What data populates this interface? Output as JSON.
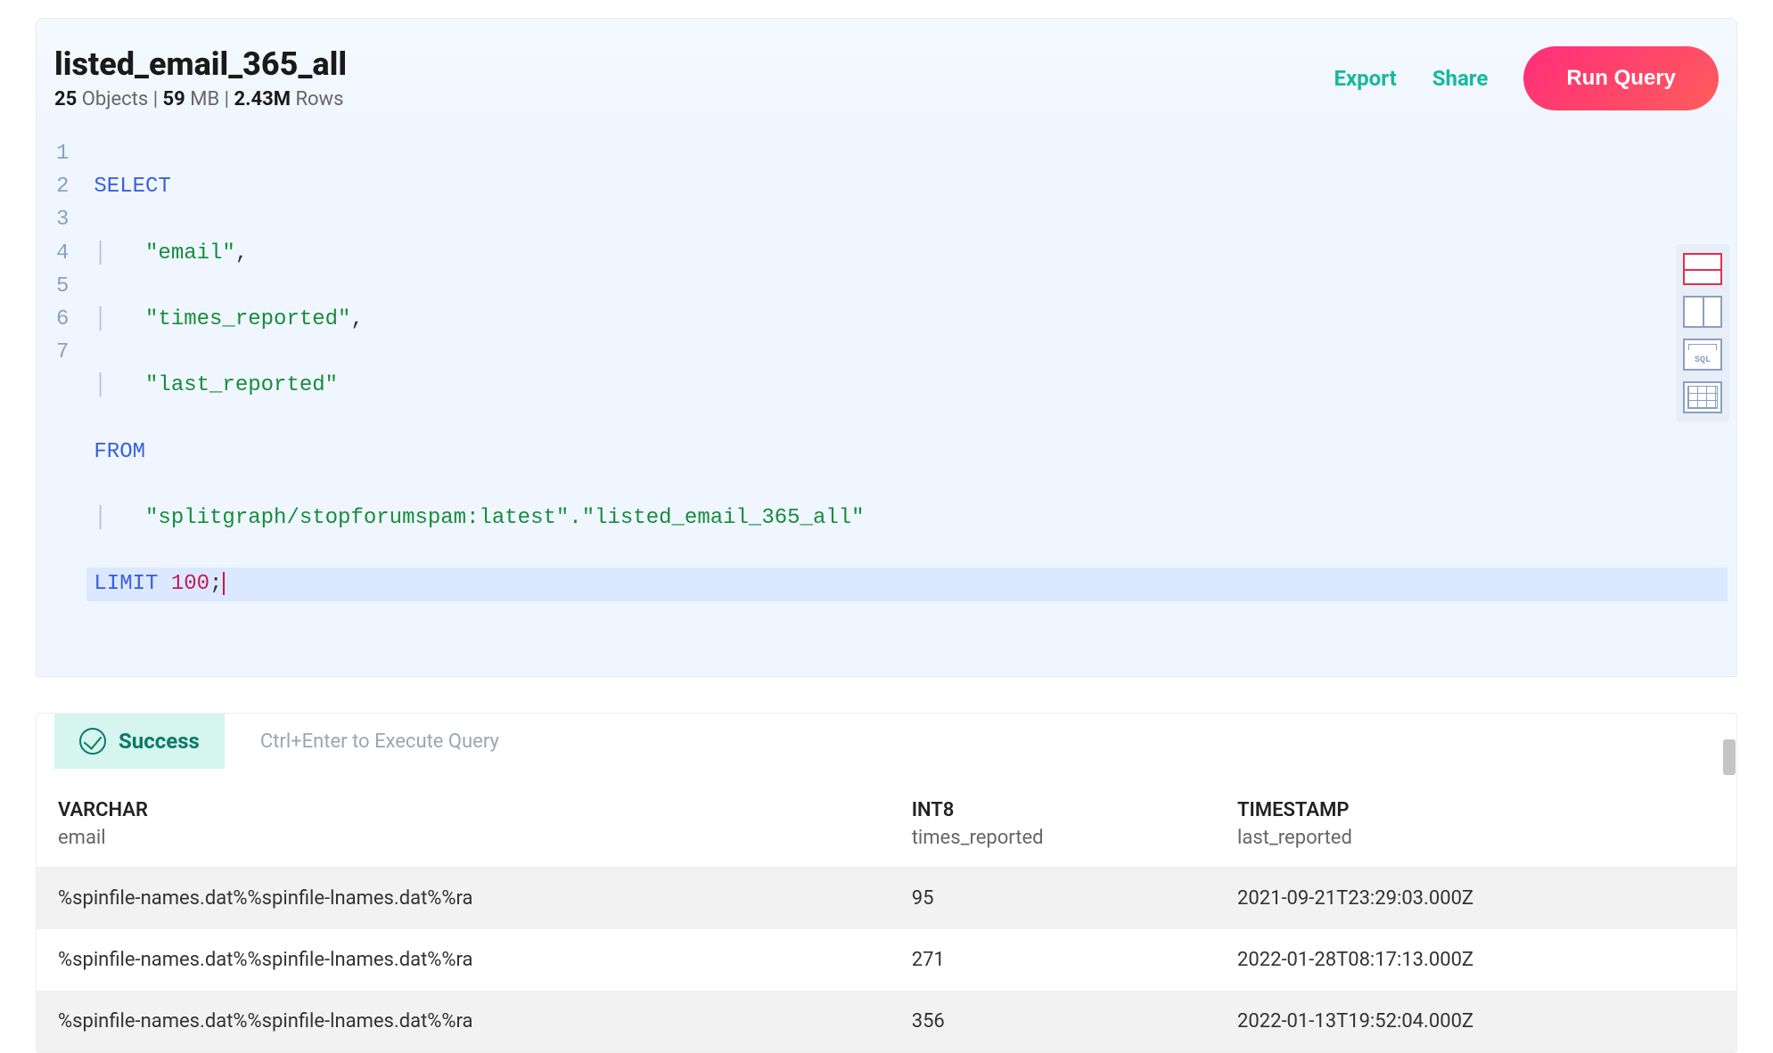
{
  "header": {
    "title": "listed_email_365_all",
    "objects_count": "25",
    "objects_label": "Objects",
    "size": "59",
    "size_unit": "MB",
    "rows_count": "2.43M",
    "rows_label": "Rows",
    "export_label": "Export",
    "share_label": "Share",
    "run_label": "Run Query"
  },
  "editor": {
    "lines": [
      "1",
      "2",
      "3",
      "4",
      "5",
      "6",
      "7"
    ],
    "sql": {
      "select": "SELECT",
      "col1": "\"email\"",
      "col2": "\"times_reported\"",
      "col3": "\"last_reported\"",
      "from": "FROM",
      "table": "\"splitgraph/stopforumspam:latest\".\"listed_email_365_all\"",
      "limit": "LIMIT",
      "limit_n": "100",
      "semi": ";"
    }
  },
  "status": {
    "success": "Success",
    "hint": "Ctrl+Enter to Execute Query"
  },
  "columns": [
    {
      "type": "VARCHAR",
      "name": "email"
    },
    {
      "type": "INT8",
      "name": "times_reported"
    },
    {
      "type": "TIMESTAMP",
      "name": "last_reported"
    }
  ],
  "rows": [
    {
      "email": "%spinfile-names.dat%%spinfile-lnames.dat%%ra",
      "times_reported": "95",
      "last_reported": "2021-09-21T23:29:03.000Z"
    },
    {
      "email": "%spinfile-names.dat%%spinfile-lnames.dat%%ra",
      "times_reported": "271",
      "last_reported": "2022-01-28T08:17:13.000Z"
    },
    {
      "email": "%spinfile-names.dat%%spinfile-lnames.dat%%ra",
      "times_reported": "356",
      "last_reported": "2022-01-13T19:52:04.000Z"
    }
  ],
  "icons": {
    "hsplit": "layout-horizontal-split-icon",
    "vsplit": "layout-vertical-split-icon",
    "sql": "SQL",
    "table": "table-icon"
  }
}
